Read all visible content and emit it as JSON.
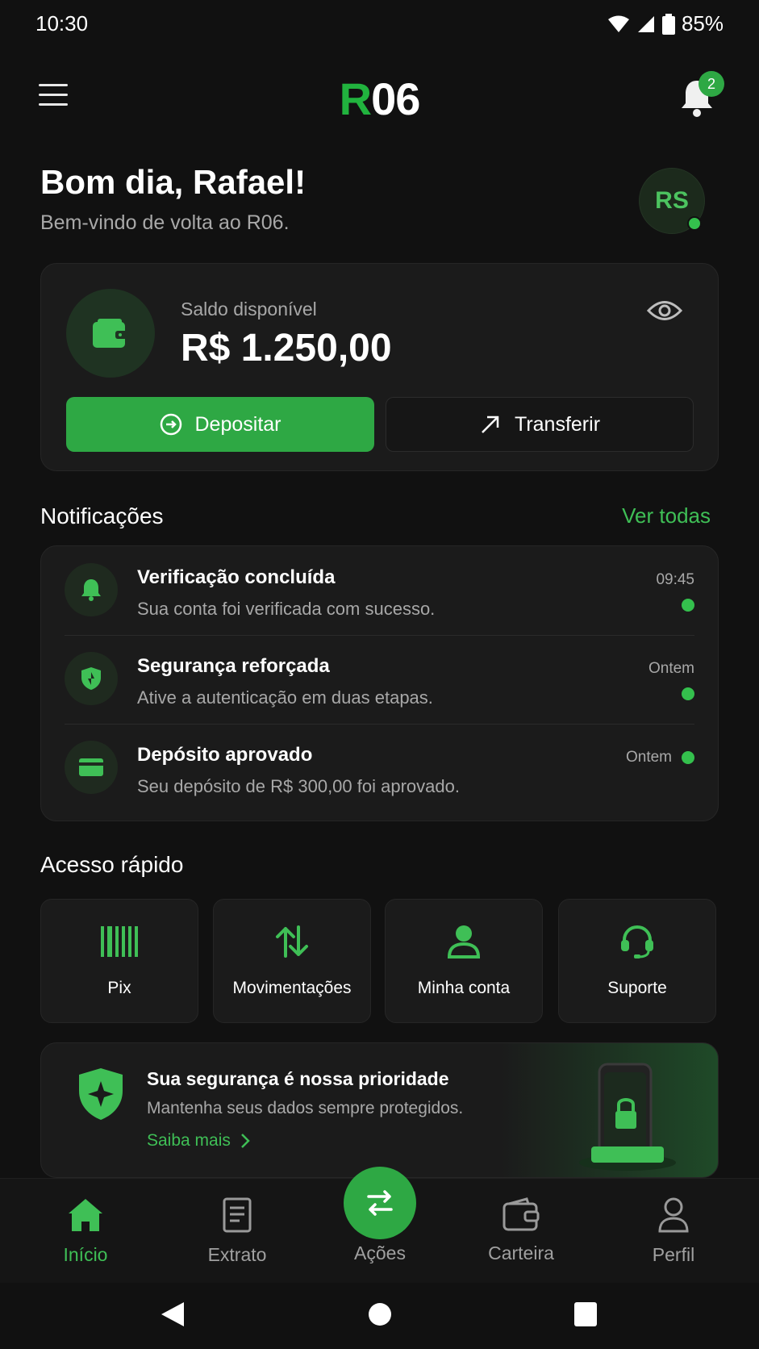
{
  "status_bar": {
    "time": "10:30",
    "battery": "85%"
  },
  "header": {
    "logo_r": "R",
    "logo_rest": "06",
    "notification_count": "2"
  },
  "greeting": {
    "title": "Bom dia, Rafael!",
    "subtitle": "Bem-vindo de volta ao R06.",
    "avatar_initials": "RS"
  },
  "balance": {
    "label": "Saldo disponível",
    "value": "R$ 1.250,00",
    "deposit_label": "Depositar",
    "transfer_label": "Transferir"
  },
  "notifications": {
    "title": "Notificações",
    "see_all": "Ver todas",
    "items": [
      {
        "icon": "bell-icon",
        "title": "Verificação concluída",
        "subtitle": "Sua conta foi verificada com sucesso.",
        "time": "09:45"
      },
      {
        "icon": "shield-icon",
        "title": "Segurança reforçada",
        "subtitle": "Ative a autenticação em duas etapas.",
        "time": "Ontem"
      },
      {
        "icon": "card-icon",
        "title": "Depósito aprovado",
        "subtitle": "Seu depósito de R$ 300,00 foi aprovado.",
        "time": "Ontem"
      }
    ]
  },
  "quick_access": {
    "title": "Acesso rápido",
    "items": [
      {
        "icon": "barcode-icon",
        "label": "Pix"
      },
      {
        "icon": "transfer-arrows-icon",
        "label": "Movimentações"
      },
      {
        "icon": "user-icon",
        "label": "Minha conta"
      },
      {
        "icon": "headset-icon",
        "label": "Suporte"
      }
    ]
  },
  "security_banner": {
    "title": "Sua segurança é nossa prioridade",
    "subtitle": "Mantenha seus dados sempre protegidos.",
    "link": "Saiba mais"
  },
  "bottom_nav": {
    "items": [
      {
        "icon": "home-icon",
        "label": "Início",
        "active": true
      },
      {
        "icon": "document-icon",
        "label": "Extrato"
      },
      {
        "icon": "actions-icon",
        "label": "Ações"
      },
      {
        "icon": "wallet-icon",
        "label": "Carteira"
      },
      {
        "icon": "person-icon",
        "label": "Perfil"
      }
    ]
  },
  "colors": {
    "accent": "#2ea844",
    "background": "#111111",
    "card": "#1b1b1b"
  }
}
